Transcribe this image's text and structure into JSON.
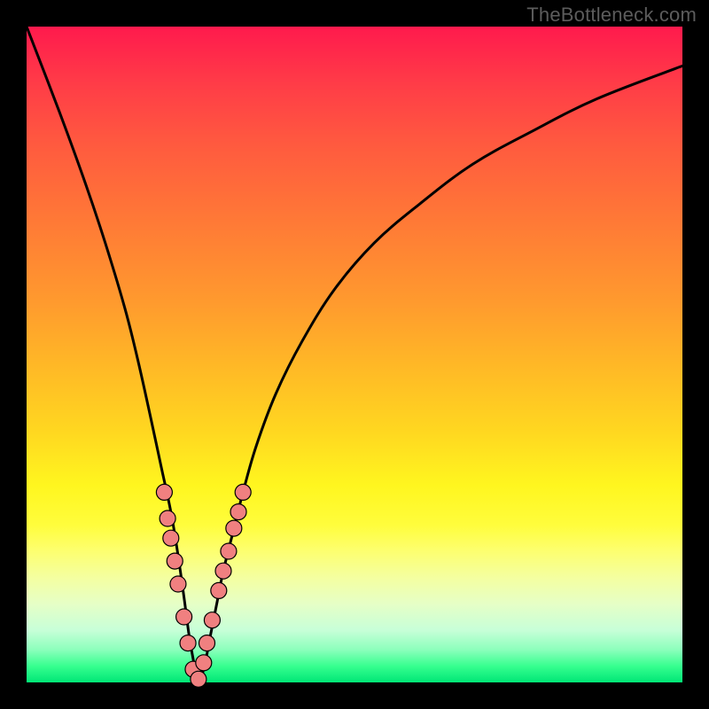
{
  "watermark": "TheBottleneck.com",
  "colors": {
    "curve_stroke": "#000000",
    "marker_fill": "#f08080",
    "marker_stroke": "#000000"
  },
  "chart_data": {
    "type": "line",
    "title": "",
    "xlabel": "",
    "ylabel": "",
    "xlim": [
      0,
      100
    ],
    "ylim": [
      0,
      100
    ],
    "curve": {
      "x": [
        0,
        5,
        9,
        12,
        15,
        17,
        19,
        20.5,
        22,
        23,
        24,
        24.8,
        25.5,
        26,
        27,
        28,
        29,
        30,
        31.5,
        33,
        35,
        38,
        42,
        47,
        53,
        60,
        68,
        77,
        87,
        100
      ],
      "y": [
        100,
        87,
        76,
        67,
        57,
        49,
        40,
        33,
        26,
        20,
        13,
        7,
        3,
        0,
        2,
        7,
        12,
        17,
        23,
        29,
        36,
        44,
        52,
        60,
        67,
        73,
        79,
        84,
        89,
        94
      ]
    },
    "markers": [
      {
        "x": 21.0,
        "y": 29
      },
      {
        "x": 21.5,
        "y": 25
      },
      {
        "x": 22.0,
        "y": 22
      },
      {
        "x": 22.6,
        "y": 18.5
      },
      {
        "x": 23.1,
        "y": 15
      },
      {
        "x": 24.0,
        "y": 10
      },
      {
        "x": 24.6,
        "y": 6
      },
      {
        "x": 25.4,
        "y": 2
      },
      {
        "x": 26.2,
        "y": 0.5
      },
      {
        "x": 27.0,
        "y": 3
      },
      {
        "x": 27.5,
        "y": 6
      },
      {
        "x": 28.3,
        "y": 9.5
      },
      {
        "x": 29.3,
        "y": 14
      },
      {
        "x": 30.0,
        "y": 17
      },
      {
        "x": 30.8,
        "y": 20
      },
      {
        "x": 31.6,
        "y": 23.5
      },
      {
        "x": 32.3,
        "y": 26
      },
      {
        "x": 33.0,
        "y": 29
      }
    ]
  }
}
